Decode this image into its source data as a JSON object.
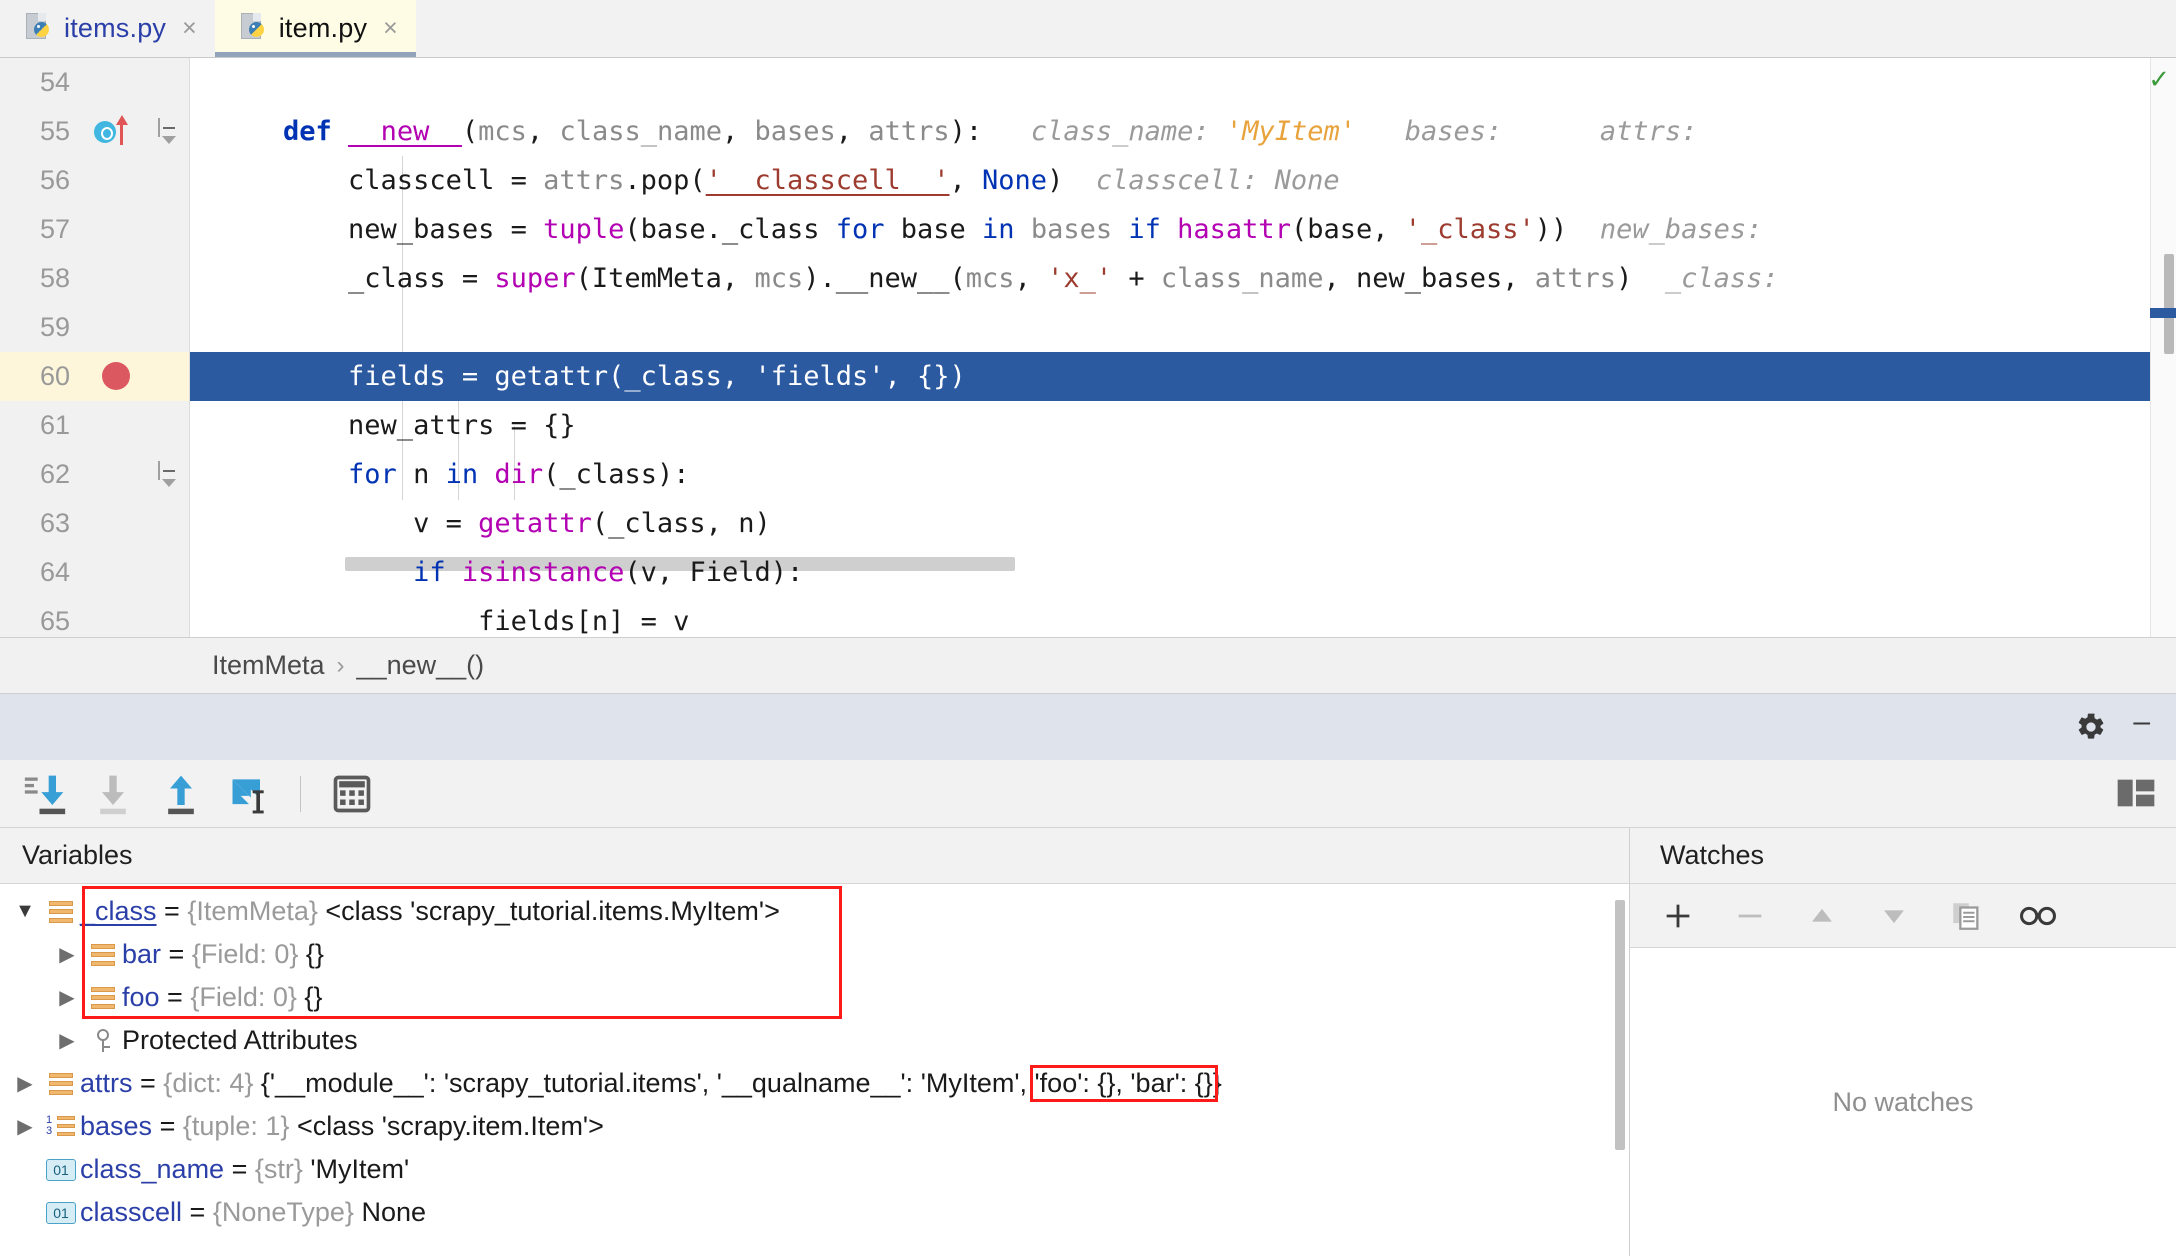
{
  "tabs": [
    {
      "label": "items.py",
      "icon": "python-file-icon",
      "close": "×",
      "active": false
    },
    {
      "label": "item.py",
      "icon": "python-file-icon",
      "close": "×",
      "active": true
    }
  ],
  "editor": {
    "language": "python",
    "first_visible_line": 54,
    "current_line": 60,
    "breakpoint_line": 60,
    "status_icon": "inspection-ok-check",
    "lines": [
      {
        "num": "54",
        "tokens": []
      },
      {
        "num": "55",
        "gutter_icon": "run-method-icon",
        "fold": "collapse-icon",
        "tokens": [
          {
            "t": "plain",
            "v": "    "
          },
          {
            "t": "kw",
            "v": "def"
          },
          {
            "t": "plain",
            "v": " "
          },
          {
            "t": "magic",
            "v": "__new__"
          },
          {
            "t": "plain",
            "v": "("
          },
          {
            "t": "param",
            "v": "mcs"
          },
          {
            "t": "plain",
            "v": ", "
          },
          {
            "t": "param",
            "v": "class_name"
          },
          {
            "t": "plain",
            "v": ", "
          },
          {
            "t": "param",
            "v": "bases"
          },
          {
            "t": "plain",
            "v": ", "
          },
          {
            "t": "param",
            "v": "attrs"
          },
          {
            "t": "plain",
            "v": "):"
          },
          {
            "t": "hint",
            "v": "   class_name: "
          },
          {
            "t": "hint-val",
            "v": "'MyItem'"
          },
          {
            "t": "hint",
            "v": "   bases:      attrs:"
          }
        ]
      },
      {
        "num": "56",
        "tokens": [
          {
            "t": "plain",
            "v": "        classcell = "
          },
          {
            "t": "param",
            "v": "attrs"
          },
          {
            "t": "plain",
            "v": ".pop("
          },
          {
            "t": "strU",
            "v": "'__classcell__'"
          },
          {
            "t": "plain",
            "v": ", "
          },
          {
            "t": "none",
            "v": "None"
          },
          {
            "t": "plain",
            "v": ")"
          },
          {
            "t": "hint",
            "v": "  classcell: None"
          }
        ]
      },
      {
        "num": "57",
        "tokens": [
          {
            "t": "plain",
            "v": "        new_bases = "
          },
          {
            "t": "builtin",
            "v": "tuple"
          },
          {
            "t": "plain",
            "v": "(base._class "
          },
          {
            "t": "kw2",
            "v": "for"
          },
          {
            "t": "plain",
            "v": " base "
          },
          {
            "t": "kw2",
            "v": "in"
          },
          {
            "t": "plain",
            "v": " "
          },
          {
            "t": "param",
            "v": "bases"
          },
          {
            "t": "plain",
            "v": " "
          },
          {
            "t": "kw2",
            "v": "if"
          },
          {
            "t": "plain",
            "v": " "
          },
          {
            "t": "builtin",
            "v": "hasattr"
          },
          {
            "t": "plain",
            "v": "(base, "
          },
          {
            "t": "str",
            "v": "'_class'"
          },
          {
            "t": "plain",
            "v": "))"
          },
          {
            "t": "hint",
            "v": "  new_bases:"
          }
        ]
      },
      {
        "num": "58",
        "tokens": [
          {
            "t": "plain",
            "v": "        _class = "
          },
          {
            "t": "builtin",
            "v": "super"
          },
          {
            "t": "plain",
            "v": "(ItemMeta, "
          },
          {
            "t": "param",
            "v": "mcs"
          },
          {
            "t": "plain",
            "v": ").__new__("
          },
          {
            "t": "param",
            "v": "mcs"
          },
          {
            "t": "plain",
            "v": ", "
          },
          {
            "t": "str",
            "v": "'x_'"
          },
          {
            "t": "plain",
            "v": " + "
          },
          {
            "t": "param",
            "v": "class_name"
          },
          {
            "t": "plain",
            "v": ", new_bases, "
          },
          {
            "t": "param",
            "v": "attrs"
          },
          {
            "t": "plain",
            "v": ")"
          },
          {
            "t": "hint",
            "v": "  _class:"
          }
        ]
      },
      {
        "num": "59",
        "tokens": []
      },
      {
        "num": "60",
        "selected": true,
        "breakpoint": true,
        "tokens": [
          {
            "t": "plain",
            "v": "        fields = "
          },
          {
            "t": "builtin",
            "v": "getattr"
          },
          {
            "t": "plain",
            "v": "(_class, "
          },
          {
            "t": "str",
            "v": "'fields'"
          },
          {
            "t": "plain",
            "v": ", {})"
          }
        ]
      },
      {
        "num": "61",
        "tokens": [
          {
            "t": "plain",
            "v": "        new_attrs = {}"
          }
        ]
      },
      {
        "num": "62",
        "fold": "collapse-icon-small",
        "tokens": [
          {
            "t": "plain",
            "v": "        "
          },
          {
            "t": "kw2",
            "v": "for"
          },
          {
            "t": "plain",
            "v": " n "
          },
          {
            "t": "kw2",
            "v": "in"
          },
          {
            "t": "plain",
            "v": " "
          },
          {
            "t": "builtin",
            "v": "dir"
          },
          {
            "t": "plain",
            "v": "(_class):"
          }
        ]
      },
      {
        "num": "63",
        "tokens": [
          {
            "t": "plain",
            "v": "            v = "
          },
          {
            "t": "builtin",
            "v": "getattr"
          },
          {
            "t": "plain",
            "v": "(_class, n)"
          }
        ]
      },
      {
        "num": "64",
        "tokens": [
          {
            "t": "plain",
            "v": "            "
          },
          {
            "t": "kw2",
            "v": "if"
          },
          {
            "t": "plain",
            "v": " "
          },
          {
            "t": "builtin",
            "v": "isinstance"
          },
          {
            "t": "plain",
            "v": "(v, Field):"
          }
        ]
      },
      {
        "num": "65",
        "tokens": [
          {
            "t": "plain",
            "v": "                fields[n] = v"
          }
        ]
      }
    ]
  },
  "breadcrumb": {
    "items": [
      "ItemMeta",
      "__new__()"
    ],
    "separator": "›"
  },
  "debug_header": {
    "settings_icon": "gear-icon",
    "minimize_icon": "minimize-icon"
  },
  "debug_toolbar": {
    "buttons": [
      {
        "name": "step-over-button",
        "label": "Step Over",
        "enabled": true
      },
      {
        "name": "step-into-button",
        "label": "Step Into",
        "enabled": false
      },
      {
        "name": "step-out-button",
        "label": "Step Out",
        "enabled": true
      },
      {
        "name": "run-to-cursor-button",
        "label": "Run to Cursor",
        "enabled": true
      },
      {
        "name": "evaluate-expression-button",
        "label": "Evaluate Expression",
        "enabled": true
      }
    ],
    "layout_button": "restore-layout-icon"
  },
  "variables": {
    "title": "Variables",
    "rows": [
      {
        "indent": 0,
        "twisty": "expanded",
        "icon": "field-icon",
        "name": "_class",
        "name_underline": true,
        "eq": " = ",
        "type": "{ItemMeta}",
        "value": " <class 'scrapy_tutorial.items.MyItem'>",
        "highlight": "red-box-start"
      },
      {
        "indent": 1,
        "twisty": "collapsed",
        "icon": "field-icon",
        "name": "bar",
        "eq": " = ",
        "type": "{Field: 0}",
        "value": " {}"
      },
      {
        "indent": 1,
        "twisty": "collapsed",
        "icon": "field-icon",
        "name": "foo",
        "eq": " = ",
        "type": "{Field: 0}",
        "value": " {}",
        "highlight": "red-box-end"
      },
      {
        "indent": 1,
        "twisty": "collapsed",
        "icon": "protected-key-icon",
        "name": "",
        "eq": "",
        "type": "",
        "value": "Protected Attributes",
        "group": true
      },
      {
        "indent": 0,
        "twisty": "collapsed",
        "icon": "field-icon",
        "name": "attrs",
        "eq": " = ",
        "type": "{dict: 4}",
        "value": " {'__module__': 'scrapy_tutorial.items', '__qualname__': 'MyItem', ",
        "value_boxed": "'foo': {}, 'bar': {}",
        "value_tail": "}"
      },
      {
        "indent": 0,
        "twisty": "collapsed",
        "icon": "tuple-icon",
        "name": "bases",
        "eq": " = ",
        "type": "{tuple: 1}",
        "value": " <class 'scrapy.item.Item'>"
      },
      {
        "indent": 0,
        "twisty": "none",
        "icon": "string-icon",
        "name": "class_name",
        "eq": " = ",
        "type": "{str}",
        "value": " 'MyItem'"
      },
      {
        "indent": 0,
        "twisty": "none",
        "icon": "string-icon",
        "name": "classcell",
        "eq": " = ",
        "type": "{NoneType}",
        "value": " None"
      }
    ]
  },
  "watches": {
    "title": "Watches",
    "toolbar": [
      {
        "name": "add-watch-button",
        "glyph": "+",
        "enabled": true
      },
      {
        "name": "remove-watch-button",
        "glyph": "−",
        "enabled": false
      },
      {
        "name": "move-watch-up-button",
        "glyph": "▲",
        "enabled": false
      },
      {
        "name": "move-watch-down-button",
        "glyph": "▼",
        "enabled": false
      },
      {
        "name": "copy-watch-button",
        "glyph": "copy-icon",
        "enabled": false
      },
      {
        "name": "inspect-watch-button",
        "glyph": "glasses-icon",
        "enabled": true
      }
    ],
    "empty_text": "No watches"
  },
  "colors": {
    "selection_blue": "#2c5aa0",
    "breakpoint_red": "#db5860",
    "annotation_red": "#ff1a1a",
    "keyword_blue": "#0033b3",
    "builtin_magenta": "#b200b2",
    "string_red": "#9c3b2e",
    "variable_blue": "#2b3fa8",
    "hint_gray": "#9a9a9a",
    "hint_value_orange": "#e8a33d",
    "active_tab_bg": "#fffce6",
    "panel_bg": "#f2f2f2"
  }
}
